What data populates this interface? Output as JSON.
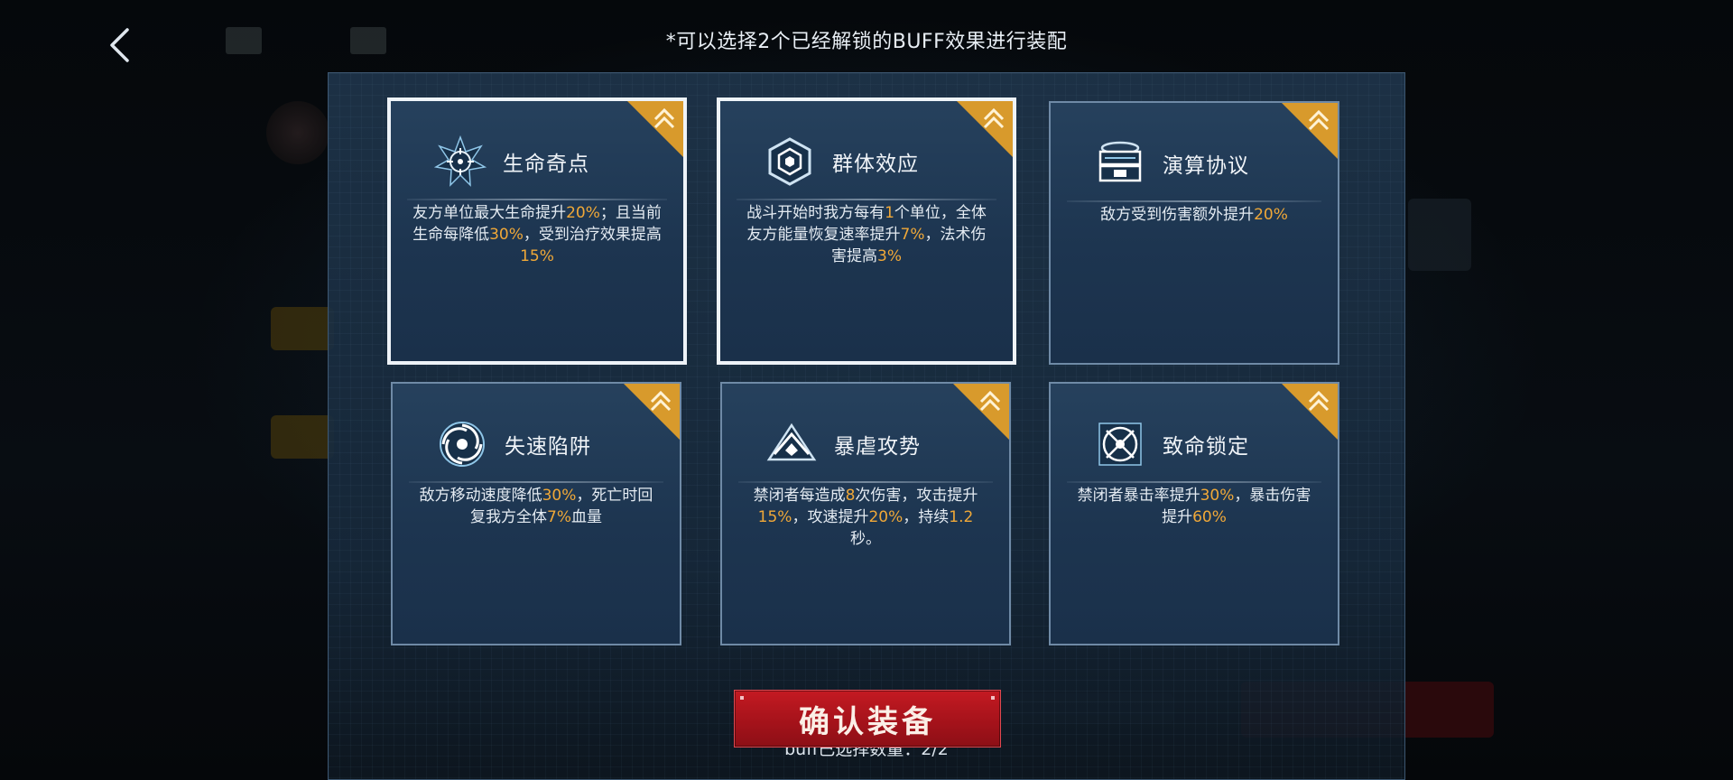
{
  "header": {
    "hint": "*可以选择2个已经解锁的BUFF效果进行装配"
  },
  "icons": {
    "back": "chevron-left-icon",
    "rank": "double-chevron-up-icon"
  },
  "colors": {
    "highlight": "#f0a838",
    "corner_badge": "#d89a2c",
    "confirm_button": "#b3161e",
    "card_bg": "#1f3854"
  },
  "cards": [
    {
      "name": "生命奇点",
      "icon": "star-crosshair-icon",
      "selected": true,
      "desc": [
        {
          "t": "友方单位最大生命提升",
          "h": false
        },
        {
          "t": "20%",
          "h": true
        },
        {
          "t": "；",
          "h": false
        },
        {
          "t": "且当前生命每降低",
          "h": false
        },
        {
          "t": "30%",
          "h": true
        },
        {
          "t": "，受到治疗效果提高",
          "h": false
        },
        {
          "t": "15%",
          "h": true
        }
      ]
    },
    {
      "name": "群体效应",
      "icon": "hexagon-cog-icon",
      "selected": true,
      "desc": [
        {
          "t": "战斗开始时我方每有",
          "h": false
        },
        {
          "t": "1",
          "h": true
        },
        {
          "t": "个单位，全体友方能量恢复速率提升",
          "h": false
        },
        {
          "t": "7%",
          "h": true
        },
        {
          "t": "，法术伤害提高",
          "h": false
        },
        {
          "t": "3%",
          "h": true
        }
      ]
    },
    {
      "name": "演算协议",
      "icon": "server-chest-icon",
      "selected": false,
      "desc": [
        {
          "t": "敌方受到伤害额外提升",
          "h": false
        },
        {
          "t": "20%",
          "h": true
        }
      ]
    },
    {
      "name": "失速陷阱",
      "icon": "vortex-icon",
      "selected": false,
      "desc": [
        {
          "t": "敌方移动速度降低",
          "h": false
        },
        {
          "t": "30%",
          "h": true
        },
        {
          "t": "，死亡时回复我方全体",
          "h": false
        },
        {
          "t": "7%",
          "h": true
        },
        {
          "t": "血量",
          "h": false
        }
      ]
    },
    {
      "name": "暴虐攻势",
      "icon": "chevron-eye-icon",
      "selected": false,
      "desc": [
        {
          "t": "禁闭者每造成",
          "h": false
        },
        {
          "t": "8",
          "h": true
        },
        {
          "t": "次伤害，攻击提升",
          "h": false
        },
        {
          "t": "15%",
          "h": true
        },
        {
          "t": "，攻速提升",
          "h": false
        },
        {
          "t": "20%",
          "h": true
        },
        {
          "t": "，持续",
          "h": false
        },
        {
          "t": "1.2",
          "h": true
        },
        {
          "t": "秒。",
          "h": false
        }
      ]
    },
    {
      "name": "致命锁定",
      "icon": "target-lock-icon",
      "selected": false,
      "desc": [
        {
          "t": "禁闭者暴击率提升",
          "h": false
        },
        {
          "t": "30%",
          "h": true
        },
        {
          "t": "，暴击伤害提升",
          "h": false
        },
        {
          "t": "60%",
          "h": true
        }
      ]
    }
  ],
  "footer": {
    "count_label": "buff已选择数量：2/2",
    "confirm_label": "确认装备"
  }
}
